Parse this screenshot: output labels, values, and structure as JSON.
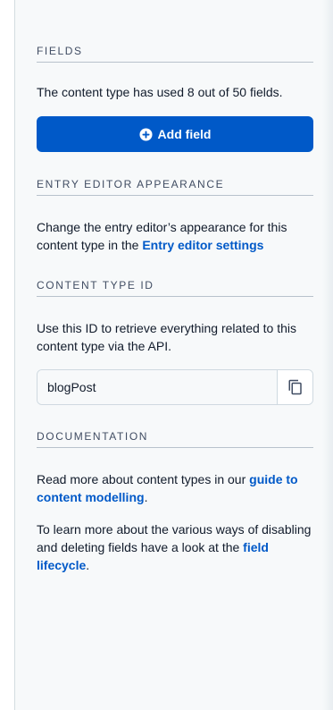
{
  "fields": {
    "heading": "FIELDS",
    "usage_text": "The content type has used 8 out of 50 fields.",
    "add_button_label": "Add field"
  },
  "entry_editor": {
    "heading": "ENTRY EDITOR APPEARANCE",
    "text_before_link": "Change the entry editor’s appearance for this content type in the ",
    "link_label": "Entry editor settings"
  },
  "content_type_id": {
    "heading": "CONTENT TYPE ID",
    "description": "Use this ID to retrieve everything related to this content type via the API.",
    "value": "blogPost"
  },
  "documentation": {
    "heading": "DOCUMENTATION",
    "para1_text": "Read more about content types in our ",
    "para1_link": "guide to content modelling",
    "para1_end": ".",
    "para2_text": "To learn more about the various ways of disabling and deleting fields have a look at the ",
    "para2_link": "field lifecycle",
    "para2_end": "."
  },
  "colors": {
    "primary_blue": "#0059c8",
    "panel_background": "#f7f9fa",
    "text": "#111b2b",
    "heading_text": "#414d63"
  },
  "icons": {
    "add": "plus-circle-icon",
    "copy": "copy-icon"
  }
}
